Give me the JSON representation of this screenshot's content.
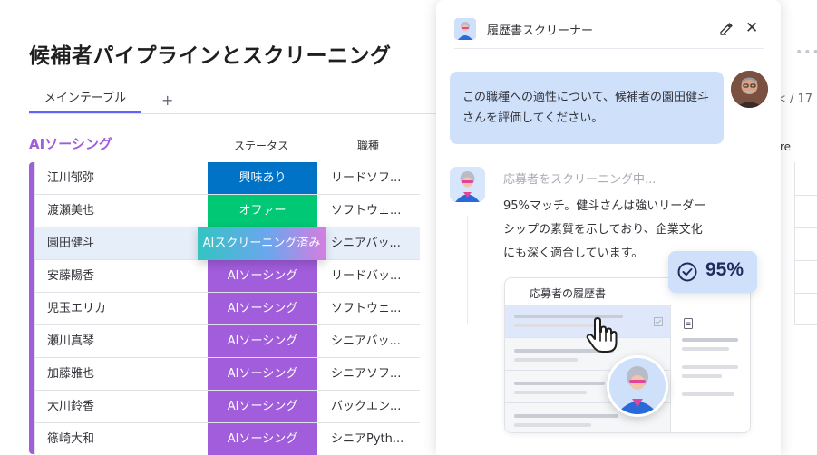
{
  "board": {
    "title": "候補者パイプラインとスクリーニング",
    "tabs": [
      {
        "label": "メインテーブル"
      }
    ],
    "add_tab_label": "+",
    "group_title": "AIソーシング",
    "group_color": "#a25ddc",
    "columns": {
      "status": "ステータス",
      "role": "職種",
      "score_partial": "re"
    },
    "pager": "< / 17",
    "more_icon": "more-dots-icon",
    "rows": [
      {
        "name": "江川郁弥",
        "status": "興味あり",
        "status_color": "#0073c7",
        "role": "リードソフ..."
      },
      {
        "name": "渡瀬美也",
        "status": "オファー",
        "status_color": "#00c875",
        "role": "ソフトウェ..."
      },
      {
        "name": "園田健斗",
        "status": "",
        "status_color": "",
        "role": "シニアバッ..."
      },
      {
        "name": "安藤陽香",
        "status": "AIソーシング",
        "status_color": "#a25ddc",
        "role": "リードバッ..."
      },
      {
        "name": "児玉エリカ",
        "status": "AIソーシング",
        "status_color": "#a25ddc",
        "role": "ソフトウェ..."
      },
      {
        "name": "瀬川真琴",
        "status": "AIソーシング",
        "status_color": "#a25ddc",
        "role": "シニアバッ..."
      },
      {
        "name": "加藤雅也",
        "status": "AIソーシング",
        "status_color": "#a25ddc",
        "role": "シニアソフ..."
      },
      {
        "name": "大川鈴香",
        "status": "AIソーシング",
        "status_color": "#a25ddc",
        "role": "バックエン..."
      },
      {
        "name": "篠崎大和",
        "status": "AIソーシング",
        "status_color": "#a25ddc",
        "role": "シニアPyth..."
      }
    ],
    "floating_status": "AIスクリーニング済み"
  },
  "panel": {
    "title": "履歴書スクリーナー",
    "user_message": "この職種への適性について、候補者の園田健斗さんを評価してください。",
    "bot_status": "応募者をスクリーニング中...",
    "bot_message": "95%マッチ。健斗さんは強いリーダーシップの素質を示しており、企業文化にも深く適合しています。",
    "resume_card_title": "応募者の履歴書",
    "score": "95%",
    "accent_color": "#cfe0fb"
  }
}
